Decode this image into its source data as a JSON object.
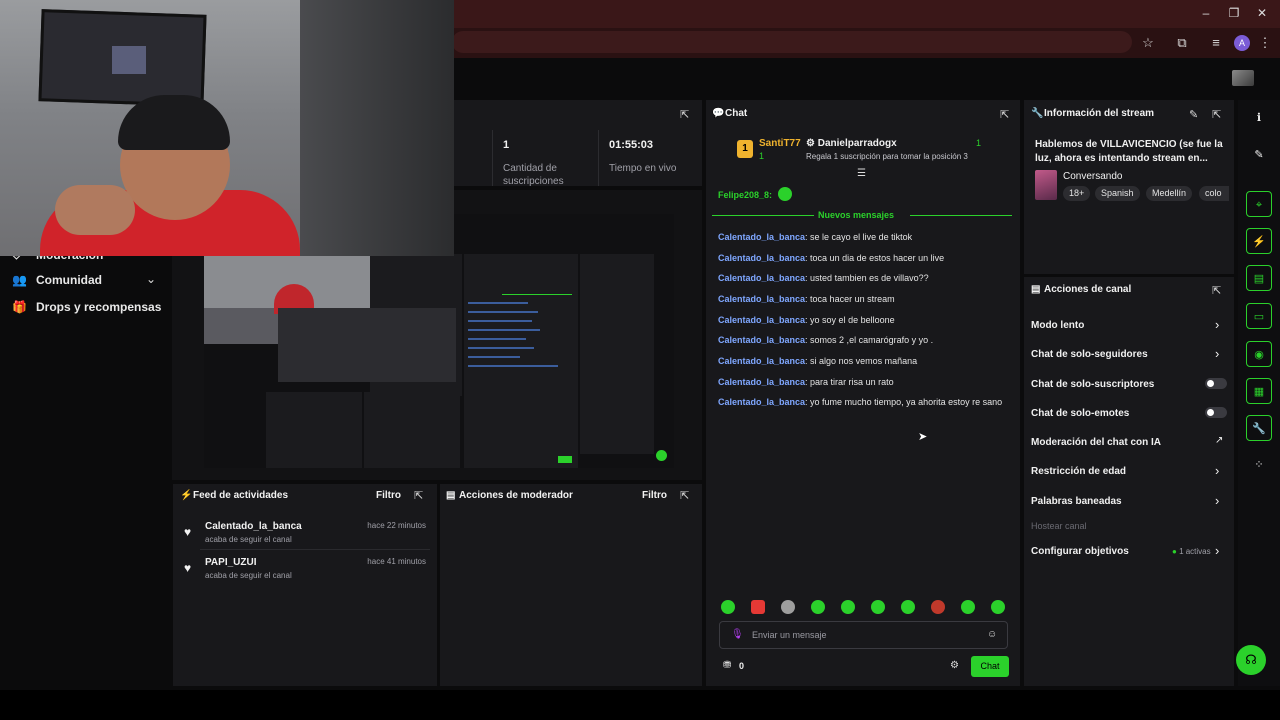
{
  "nav": {
    "items": [
      {
        "label": "Moderación"
      },
      {
        "label": "Comunidad"
      },
      {
        "label": "Drops y recompensas"
      }
    ]
  },
  "stats": {
    "subs_value": "1",
    "subs_label": "Cantidad de suscripciones",
    "live_value": "01:55:03",
    "live_label": "Tiempo en vivo"
  },
  "feed": {
    "title": "Feed de actividades",
    "filter": "Filtro",
    "items": [
      {
        "name": "Calentado_la_banca",
        "action": "acaba de seguir el canal",
        "time": "hace 22 minutos"
      },
      {
        "name": "PAPI_UZUI",
        "action": "acaba de seguir el canal",
        "time": "hace 41 minutos"
      }
    ]
  },
  "mod_actions": {
    "title": "Acciones de moderador",
    "filter": "Filtro"
  },
  "chat": {
    "title": "Chat",
    "leader": {
      "rank": "1",
      "name": "SantiT77",
      "count": "1"
    },
    "gifter": {
      "name": "Danielparradogx",
      "count": "1",
      "note": "Regala 1 suscripción para tomar la posición 3"
    },
    "first_user": "Felipe208_8:",
    "new_messages": "Nuevos mensajes",
    "messages": [
      {
        "user": "Calentado_la_banca",
        "text": ": se le cayo el live de tiktok"
      },
      {
        "user": "Calentado_la_banca",
        "text": ": toca un dia de estos hacer un live"
      },
      {
        "user": "Calentado_la_banca",
        "text": ": usted tambien es de villavo??"
      },
      {
        "user": "Calentado_la_banca",
        "text": ": toca hacer un stream"
      },
      {
        "user": "Calentado_la_banca",
        "text": ": yo soy el de belloone"
      },
      {
        "user": "Calentado_la_banca",
        "text": ": somos 2 ,el camarógrafo y yo ."
      },
      {
        "user": "Calentado_la_banca",
        "text": ": si algo nos vemos mañana"
      },
      {
        "user": "Calentado_la_banca",
        "text": ": para tirar risa un rato"
      },
      {
        "user": "Calentado_la_banca",
        "text": ": yo fume mucho tiempo, ya ahorita estoy re sano"
      }
    ],
    "input_placeholder": "Enviar un mensaje",
    "points": "0",
    "send_label": "Chat"
  },
  "stream_info": {
    "title": "Información del stream",
    "stream_title": "Hablemos de VILLAVICENCIO (se fue la luz, ahora es intentando stream en...",
    "category": "Conversando",
    "tags": [
      "18+",
      "Spanish",
      "Medellín",
      "colo"
    ]
  },
  "channel_actions": {
    "title": "Acciones de canal",
    "items": [
      {
        "label": "Modo lento",
        "control": "chevron"
      },
      {
        "label": "Chat de solo-seguidores",
        "control": "chevron"
      },
      {
        "label": "Chat de solo-suscriptores",
        "control": "toggle"
      },
      {
        "label": "Chat de solo-emotes",
        "control": "toggle"
      },
      {
        "label": "Moderación del chat con IA",
        "control": "external"
      },
      {
        "label": "Restricción de edad",
        "control": "chevron"
      },
      {
        "label": "Palabras baneadas",
        "control": "chevron"
      },
      {
        "label": "Hostear canal",
        "control": "none"
      },
      {
        "label": "Configurar objetivos",
        "control": "chevron",
        "badge": "1 activas"
      }
    ]
  },
  "colors": {
    "accent": "#2bd12b",
    "username": "#7fa7ff",
    "panel": "#18181b"
  }
}
